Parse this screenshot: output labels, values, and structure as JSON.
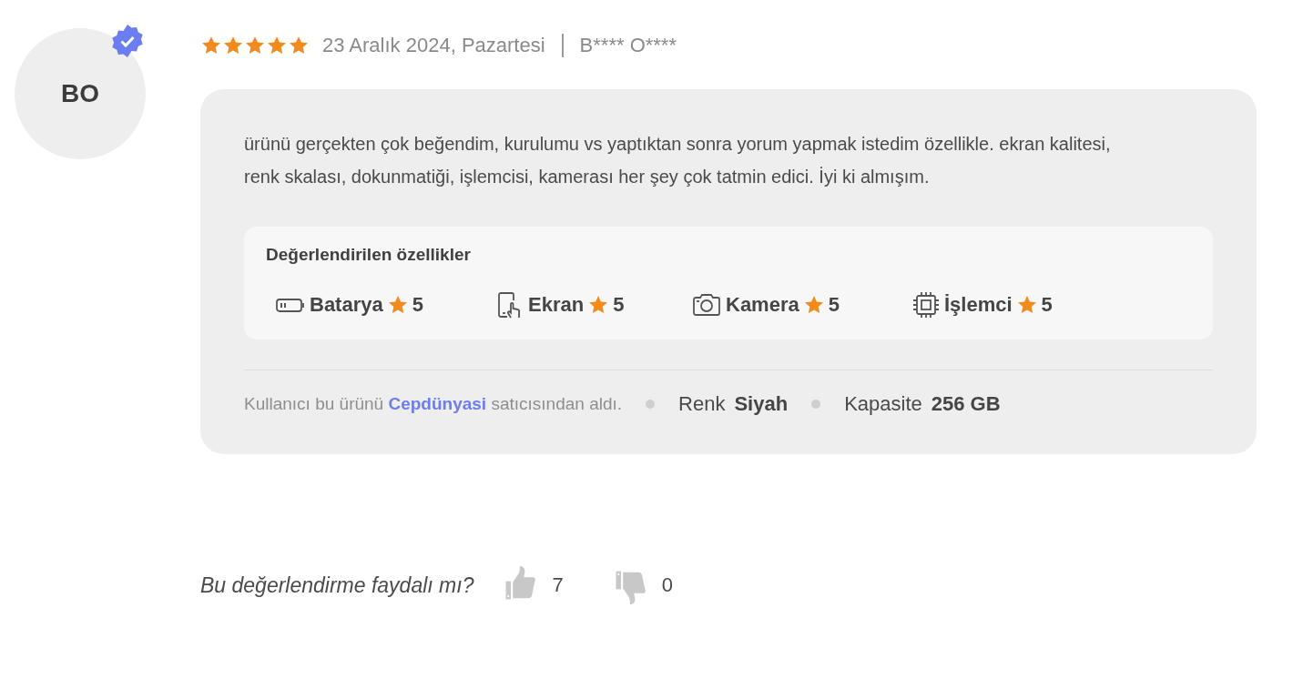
{
  "reviewer": {
    "initials": "BO",
    "verified": true,
    "name": "B**** O****"
  },
  "review": {
    "stars": 5,
    "date": "23 Aralık 2024, Pazartesi",
    "text": "ürünü gerçekten çok beğendim, kurulumu vs yaptıktan sonra yorum yapmak istedim özellikle. ekran kalitesi, renk skalası, dokunmatiği, işlemcisi, kamerası her şey çok tatmin edici. İyi ki almışım."
  },
  "rated_features": {
    "title": "Değerlendirilen özellikler",
    "items": [
      {
        "kind": "battery",
        "label": "Batarya",
        "rating": "5"
      },
      {
        "kind": "screen",
        "label": "Ekran",
        "rating": "5"
      },
      {
        "kind": "camera",
        "label": "Kamera",
        "rating": "5"
      },
      {
        "kind": "processor",
        "label": "İşlemci",
        "rating": "5"
      }
    ]
  },
  "purchase_note": {
    "prefix": "Kullanıcı bu ürünü",
    "seller": "Cepdünyasi",
    "suffix": "satıcısından aldı."
  },
  "attributes": [
    {
      "name": "Renk",
      "value": "Siyah"
    },
    {
      "name": "Kapasite",
      "value": "256 GB"
    }
  ],
  "helpful": {
    "question": "Bu değerlendirme faydalı mı?",
    "up_count": "7",
    "down_count": "0"
  }
}
